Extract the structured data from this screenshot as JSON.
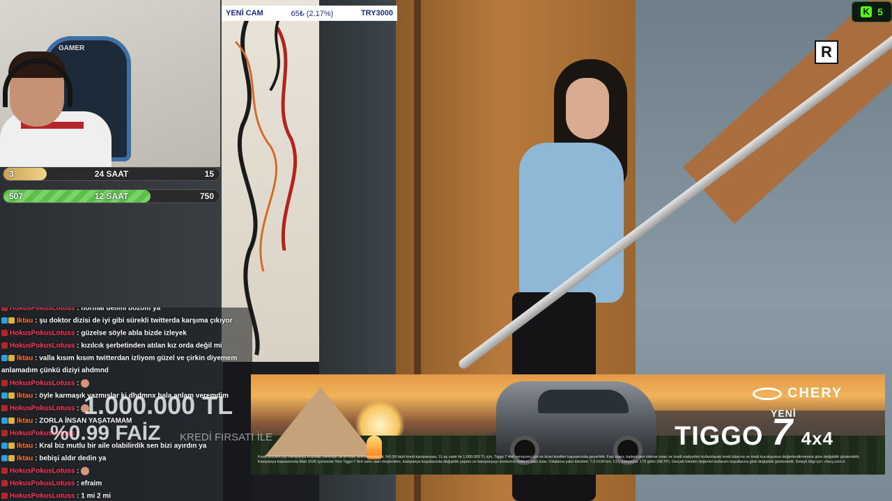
{
  "ticker": {
    "name": "YENİ CAM",
    "change": "65₺ (2.17%)",
    "goal": "TRY3000"
  },
  "kick": {
    "icon": "kick-icon",
    "count": "5"
  },
  "logo": {
    "letter": "R"
  },
  "progress_bars": [
    {
      "left": "3",
      "label": "24 SAAT",
      "right": "15",
      "progress": 0.2
    },
    {
      "left": "507",
      "label": "12 SAAT",
      "right": "750",
      "progress": 0.68
    }
  ],
  "chat": [
    {
      "user": "HokusPokusLotuss",
      "text": "normal delimi bozom ya",
      "user_color": "#ff3b5c",
      "badges": [
        "#b3262a"
      ]
    },
    {
      "user": "Iktau",
      "text": "şu doktor dizisi de iyi gibi sürekli twitterda karşıma çıkıyor",
      "user_color": "#ff7a2e",
      "badges": [
        "#2aa0e0",
        "#e0b43a"
      ]
    },
    {
      "user": "HokusPokusLotuss",
      "text": "güzelse söyle abla bizde izleyek",
      "user_color": "#ff3b5c",
      "badges": [
        "#b3262a"
      ]
    },
    {
      "user": "HokusPokusLotuss",
      "text": "kızılcık şerbetinden atılan kız orda değil mi",
      "user_color": "#ff3b5c",
      "badges": [
        "#b3262a"
      ]
    },
    {
      "user": "Iktau",
      "text": "valla kısım kısım twitterdan izliyom güzel ve çirkin diyemem anlamadım çünkü diziyi ahdmnd",
      "user_color": "#ff7a2e",
      "badges": [
        "#2aa0e0",
        "#e0b43a"
      ]
    },
    {
      "user": "HokusPokusLotuss",
      "text": "",
      "emoji": true,
      "user_color": "#ff3b5c",
      "badges": [
        "#b3262a"
      ]
    },
    {
      "user": "Iktau",
      "text": "öyle karmaşık yazmışlar ki dhdmnx hala anlam veremdim",
      "user_color": "#ff7a2e",
      "badges": [
        "#2aa0e0",
        "#e0b43a"
      ]
    },
    {
      "user": "HokusPokusLotuss",
      "text": "",
      "emoji": true,
      "user_color": "#ff3b5c",
      "badges": [
        "#b3262a"
      ]
    },
    {
      "user": "Iktau",
      "text": "ZORLA İNSAN YAŞATAMAM",
      "user_color": "#ff7a2e",
      "badges": [
        "#2aa0e0",
        "#e0b43a"
      ]
    },
    {
      "user": "HokusPokusLotuss",
      "text": "",
      "user_color": "#ff3b5c",
      "badges": [
        "#b3262a"
      ]
    },
    {
      "user": "Iktau",
      "text": "Kral biz mutlu bir aile olabilirdik sen bizi ayırdın ya",
      "user_color": "#ff7a2e",
      "badges": [
        "#2aa0e0",
        "#e0b43a"
      ]
    },
    {
      "user": "Iktau",
      "text": "bebişi aldır dedin ya",
      "user_color": "#ff7a2e",
      "badges": [
        "#2aa0e0",
        "#e0b43a"
      ]
    },
    {
      "user": "HokusPokusLotuss",
      "text": "",
      "emoji": true,
      "user_color": "#ff3b5c",
      "badges": [
        "#b3262a"
      ]
    },
    {
      "user": "HokusPokusLotuss",
      "text": "efraim",
      "user_color": "#ff3b5c",
      "badges": [
        "#b3262a"
      ]
    },
    {
      "user": "HokusPokusLotuss",
      "text": "1 mi 2 mi",
      "user_color": "#ff3b5c",
      "badges": [
        "#b3262a"
      ]
    }
  ],
  "ad": {
    "amount": "1.000.000 TL",
    "rate": "%0.99 FAİZ",
    "credit": "KREDİ FIRSATI İLE",
    "brand": "CHERY",
    "yeni": "YENİ",
    "model_prefix": "TIGGO",
    "model_number": "7",
    "model_suffix": "4x4",
    "fine_print": "Kredi ürünleri için kampanya koşulları bankalar tarafından belirlenmektedir. %0,99 faizli kredi kampanyası; 11 ay vade ile 1.000.000 TL için, Tiggo 7 4x4 versiyonu için ve ticari krediler kapsamında geçerlidir. Faiz oranı, toplam geri ödeme tutarı ve kredi maliyetleri kullanılacak kredi tutarına ve kredi kuruluşunun değerlendirmesine göre değişiklik gösterebilir. Kampanya kapsamında Mart 2026 içerisinde Yeni Tiggo 7 4x4 satın alan müşterilere, kampanya koşullarında değişiklik yapma ve kampanyayı durdurma hakkını saklı tutar. Ortalama yakıt tüketimi: 7,9 l/100 km, CO₂ emisyonu: 179 g/km (WLTP). Gerçek tüketim değerleri kullanım koşullarına göre değişiklik gösterebilir. Detaylı bilgi için: chery.com.tr"
  }
}
